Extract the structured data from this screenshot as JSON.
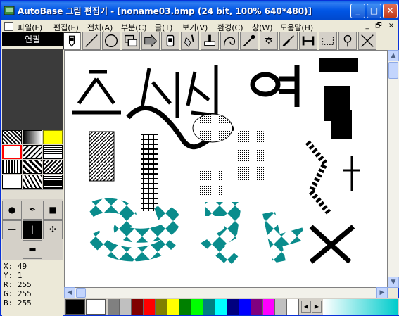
{
  "window": {
    "title": "AutoBase 그림 편집기 - [noname03.bmp (24 bit, 100% 640*480)]",
    "minimize": "_",
    "maximize": "□",
    "close": "✕",
    "mdi_minimize": "_",
    "mdi_restore": "🗗",
    "mdi_close": "×"
  },
  "menu": [
    "파일(F)",
    "편집(E)",
    "전체(A)",
    "부분(C)",
    "글(T)",
    "보기(V)",
    "환경(C)",
    "창(W)",
    "도움말(H)"
  ],
  "mode_label": "연필",
  "tools": [
    "pencil-icon",
    "line-icon",
    "circle-icon",
    "rectangle-icon",
    "arrow-shape-icon",
    "eraser-icon",
    "fill-bucket-icon",
    "stamp-icon",
    "curve-icon",
    "eyedropper-icon",
    "text-icon",
    "brush-icon",
    "measure-icon",
    "select-rect-icon",
    "lasso-icon",
    "cross-icon"
  ],
  "status": {
    "x": "X: 49",
    "y": "Y: 1",
    "r": "R: 255",
    "g": "G: 255",
    "b": "B: 255"
  },
  "palette": {
    "foreground": "#000000",
    "background": "#FFFFFF",
    "colors": [
      "#000000",
      "#FFFFFF",
      "#808080",
      "#C0C0C0",
      "#800000",
      "#FF0000",
      "#808000",
      "#FFFF00",
      "#008000",
      "#00FF00",
      "#008080",
      "#00FFFF",
      "#000080",
      "#0000FF",
      "#800080",
      "#FF00FF",
      "#C0C0C0",
      "#FFFFFF"
    ],
    "gradient_end": "#00CCCC"
  },
  "accent": "#0A5FE6"
}
